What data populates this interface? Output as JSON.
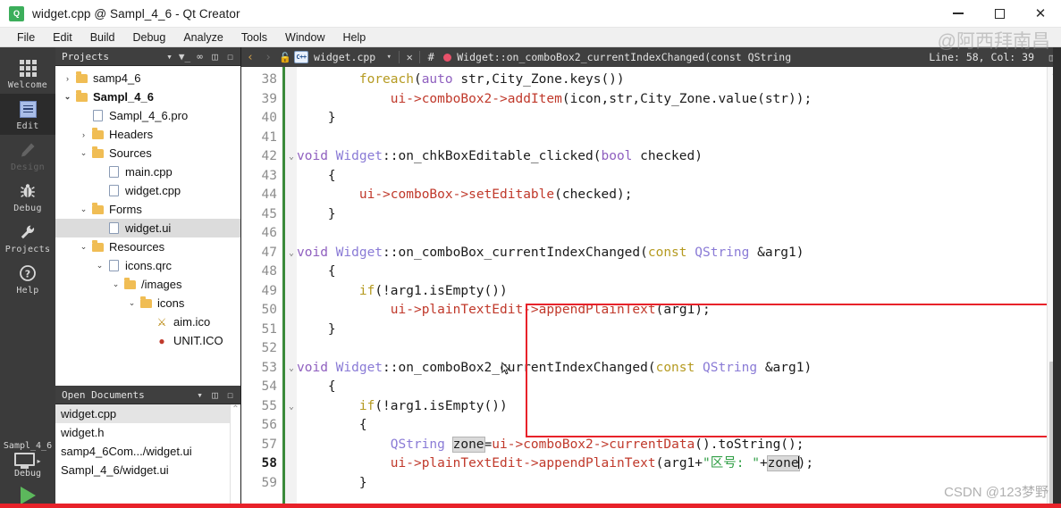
{
  "window": {
    "title": "widget.cpp @ Sampl_4_6 - Qt Creator",
    "app_icon": "qt-creator-icon",
    "minimize_label": "—",
    "maximize_label": "□",
    "close_label": "✕"
  },
  "menubar": {
    "items": [
      "File",
      "Edit",
      "Build",
      "Debug",
      "Analyze",
      "Tools",
      "Window",
      "Help"
    ]
  },
  "modebar": {
    "items": [
      {
        "label": "Welcome",
        "icon": "grid-icon",
        "state": "normal"
      },
      {
        "label": "Edit",
        "icon": "document-icon",
        "state": "active"
      },
      {
        "label": "Design",
        "icon": "pencil-icon",
        "state": "disabled"
      },
      {
        "label": "Debug",
        "icon": "bug-icon",
        "state": "normal"
      },
      {
        "label": "Projects",
        "icon": "wrench-icon",
        "state": "normal"
      },
      {
        "label": "Help",
        "icon": "question-icon",
        "state": "normal"
      }
    ],
    "kit": {
      "project": "Sampl_4_6",
      "build_config": "Debug",
      "selector_icon": "monitor-icon",
      "run_icon": "run-play-icon"
    }
  },
  "projects_panel": {
    "title": "Projects",
    "toolbar_icons": [
      "chevron-down-icon",
      "filter-icon",
      "link-icon",
      "split-icon",
      "close-icon"
    ],
    "tree": [
      {
        "label": "samp4_6",
        "depth": 0,
        "arrow": "›",
        "icon": "project-icon",
        "bold": false,
        "selected": false
      },
      {
        "label": "Sampl_4_6",
        "depth": 0,
        "arrow": "⌄",
        "icon": "project-icon",
        "bold": true,
        "selected": false
      },
      {
        "label": "Sampl_4_6.pro",
        "depth": 1,
        "arrow": "",
        "icon": "pro-file-icon",
        "bold": false,
        "selected": false
      },
      {
        "label": "Headers",
        "depth": 1,
        "arrow": "›",
        "icon": "folder-h-icon",
        "bold": false,
        "selected": false
      },
      {
        "label": "Sources",
        "depth": 1,
        "arrow": "⌄",
        "icon": "folder-c-icon",
        "bold": false,
        "selected": false
      },
      {
        "label": "main.cpp",
        "depth": 2,
        "arrow": "",
        "icon": "cpp-file-icon",
        "bold": false,
        "selected": false
      },
      {
        "label": "widget.cpp",
        "depth": 2,
        "arrow": "",
        "icon": "cpp-file-icon",
        "bold": false,
        "selected": false
      },
      {
        "label": "Forms",
        "depth": 1,
        "arrow": "⌄",
        "icon": "folder-ui-icon",
        "bold": false,
        "selected": false
      },
      {
        "label": "widget.ui",
        "depth": 2,
        "arrow": "",
        "icon": "ui-file-icon",
        "bold": false,
        "selected": true
      },
      {
        "label": "Resources",
        "depth": 1,
        "arrow": "⌄",
        "icon": "folder-qrc-icon",
        "bold": false,
        "selected": false
      },
      {
        "label": "icons.qrc",
        "depth": 2,
        "arrow": "⌄",
        "icon": "qrc-file-icon",
        "bold": false,
        "selected": false
      },
      {
        "label": "/images",
        "depth": 3,
        "arrow": "⌄",
        "icon": "folder-icon",
        "bold": false,
        "selected": false
      },
      {
        "label": "icons",
        "depth": 4,
        "arrow": "⌄",
        "icon": "folder-icon",
        "bold": false,
        "selected": false
      },
      {
        "label": "aim.ico",
        "depth": 5,
        "arrow": "",
        "icon": "aim-ico-icon",
        "bold": false,
        "selected": false
      },
      {
        "label": "UNIT.ICO",
        "depth": 5,
        "arrow": "",
        "icon": "unit-ico-icon",
        "bold": false,
        "selected": false
      }
    ]
  },
  "open_documents": {
    "title": "Open Documents",
    "toolbar_icons": [
      "chevron-down-icon",
      "split-icon",
      "close-icon"
    ],
    "scroll_up_icon": "⌃",
    "items": [
      {
        "label": "widget.cpp",
        "selected": true
      },
      {
        "label": "widget.h",
        "selected": false
      },
      {
        "label": "samp4_6Com.../widget.ui",
        "selected": false
      },
      {
        "label": "Sampl_4_6/widget.ui",
        "selected": false
      }
    ]
  },
  "editor": {
    "toolbar": {
      "back_icon": "‹",
      "forward_icon": "›",
      "lock_icon": "unlocked-icon",
      "file_icon": "cpp-file-icon",
      "filename": "widget.cpp",
      "dropdown_icon": "▾",
      "close_icon": "✕",
      "hash_icon": "#",
      "symbol_marker_icon": "bookmark-dot-icon",
      "symbol": "Widget::on_comboBox2_currentIndexChanged(const QString",
      "line_col": "Line: 58, Col: 39",
      "split_icon": "split-icon"
    },
    "first_line": 38,
    "current_line": 58,
    "lines": [
      {
        "n": 38,
        "fold": "",
        "indent": 8,
        "tokens": [
          {
            "t": "foreach",
            "c": "kw2"
          },
          {
            "t": "(",
            "c": ""
          },
          {
            "t": "auto",
            "c": "kw"
          },
          {
            "t": " str,City_Zone.keys())",
            "c": ""
          }
        ]
      },
      {
        "n": 39,
        "fold": "",
        "indent": 12,
        "tokens": [
          {
            "t": "ui",
            "c": "mem"
          },
          {
            "t": "->",
            "c": "mem"
          },
          {
            "t": "comboBox2",
            "c": "mem"
          },
          {
            "t": "->",
            "c": "mem"
          },
          {
            "t": "addItem",
            "c": "mem"
          },
          {
            "t": "(icon,str,City_Zone.value(str));",
            "c": ""
          }
        ]
      },
      {
        "n": 40,
        "fold": "",
        "indent": 4,
        "tokens": [
          {
            "t": "}",
            "c": ""
          }
        ]
      },
      {
        "n": 41,
        "fold": "",
        "indent": 0,
        "tokens": []
      },
      {
        "n": 42,
        "fold": "⌄",
        "indent": 0,
        "tokens": [
          {
            "t": "void",
            "c": "kw"
          },
          {
            "t": " ",
            "c": ""
          },
          {
            "t": "Widget",
            "c": "typ"
          },
          {
            "t": "::on_chkBoxEditable_clicked",
            "c": ""
          },
          {
            "t": "(",
            "c": ""
          },
          {
            "t": "bool",
            "c": "kw"
          },
          {
            "t": " checked)",
            "c": ""
          }
        ]
      },
      {
        "n": 43,
        "fold": "",
        "indent": 4,
        "tokens": [
          {
            "t": "{",
            "c": ""
          }
        ]
      },
      {
        "n": 44,
        "fold": "",
        "indent": 8,
        "tokens": [
          {
            "t": "ui",
            "c": "mem"
          },
          {
            "t": "->",
            "c": "mem"
          },
          {
            "t": "comboBox",
            "c": "mem"
          },
          {
            "t": "->",
            "c": "mem"
          },
          {
            "t": "setEditable",
            "c": "mem"
          },
          {
            "t": "(checked);",
            "c": ""
          }
        ]
      },
      {
        "n": 45,
        "fold": "",
        "indent": 4,
        "tokens": [
          {
            "t": "}",
            "c": ""
          }
        ]
      },
      {
        "n": 46,
        "fold": "",
        "indent": 0,
        "tokens": []
      },
      {
        "n": 47,
        "fold": "⌄",
        "indent": 0,
        "tokens": [
          {
            "t": "void",
            "c": "kw"
          },
          {
            "t": " ",
            "c": ""
          },
          {
            "t": "Widget",
            "c": "typ"
          },
          {
            "t": "::on_comboBox_currentIndexChanged",
            "c": ""
          },
          {
            "t": "(",
            "c": ""
          },
          {
            "t": "const",
            "c": "kw2"
          },
          {
            "t": " ",
            "c": ""
          },
          {
            "t": "QString",
            "c": "typ"
          },
          {
            "t": " &arg1)",
            "c": ""
          }
        ]
      },
      {
        "n": 48,
        "fold": "",
        "indent": 4,
        "tokens": [
          {
            "t": "{",
            "c": ""
          }
        ]
      },
      {
        "n": 49,
        "fold": "",
        "indent": 8,
        "tokens": [
          {
            "t": "if",
            "c": "kw2"
          },
          {
            "t": "(!arg1.isEmpty())",
            "c": ""
          }
        ]
      },
      {
        "n": 50,
        "fold": "",
        "indent": 12,
        "tokens": [
          {
            "t": "ui",
            "c": "mem"
          },
          {
            "t": "->",
            "c": "mem"
          },
          {
            "t": "plainTextEdit",
            "c": "mem"
          },
          {
            "t": "->",
            "c": "mem"
          },
          {
            "t": "appendPlainText",
            "c": "mem"
          },
          {
            "t": "(arg1);",
            "c": ""
          }
        ]
      },
      {
        "n": 51,
        "fold": "",
        "indent": 4,
        "tokens": [
          {
            "t": "}",
            "c": ""
          }
        ]
      },
      {
        "n": 52,
        "fold": "",
        "indent": 0,
        "tokens": []
      },
      {
        "n": 53,
        "fold": "⌄",
        "indent": 0,
        "tokens": [
          {
            "t": "void",
            "c": "kw"
          },
          {
            "t": " ",
            "c": ""
          },
          {
            "t": "Widget",
            "c": "typ"
          },
          {
            "t": "::on_comboBox2_currentIndexChanged",
            "c": ""
          },
          {
            "t": "(",
            "c": ""
          },
          {
            "t": "const",
            "c": "kw2"
          },
          {
            "t": " ",
            "c": ""
          },
          {
            "t": "QString",
            "c": "typ"
          },
          {
            "t": " &arg1)",
            "c": ""
          }
        ]
      },
      {
        "n": 54,
        "fold": "",
        "indent": 4,
        "tokens": [
          {
            "t": "{",
            "c": ""
          }
        ]
      },
      {
        "n": 55,
        "fold": "⌄",
        "indent": 8,
        "tokens": [
          {
            "t": "if",
            "c": "kw2"
          },
          {
            "t": "(!arg1.isEmpty())",
            "c": ""
          }
        ]
      },
      {
        "n": 56,
        "fold": "",
        "indent": 8,
        "tokens": [
          {
            "t": "{",
            "c": ""
          }
        ]
      },
      {
        "n": 57,
        "fold": "",
        "indent": 12,
        "tokens": [
          {
            "t": "QString",
            "c": "typ"
          },
          {
            "t": " ",
            "c": ""
          },
          {
            "t": "zone",
            "c": "hl"
          },
          {
            "t": "=",
            "c": ""
          },
          {
            "t": "ui",
            "c": "mem"
          },
          {
            "t": "->",
            "c": "mem"
          },
          {
            "t": "comboBox2",
            "c": "mem"
          },
          {
            "t": "->",
            "c": "mem"
          },
          {
            "t": "currentData",
            "c": "mem"
          },
          {
            "t": "().toString();",
            "c": ""
          }
        ]
      },
      {
        "n": 58,
        "fold": "",
        "indent": 12,
        "tokens": [
          {
            "t": "ui",
            "c": "mem"
          },
          {
            "t": "->",
            "c": "mem"
          },
          {
            "t": "plainTextEdit",
            "c": "mem"
          },
          {
            "t": "->",
            "c": "mem"
          },
          {
            "t": "appendPlainText",
            "c": "mem"
          },
          {
            "t": "(arg1+",
            "c": ""
          },
          {
            "t": "\"区号: \"",
            "c": "str"
          },
          {
            "t": "+",
            "c": ""
          },
          {
            "t": "zone",
            "c": "hl caret-after"
          },
          {
            "t": ");",
            "c": ""
          }
        ]
      },
      {
        "n": 59,
        "fold": "",
        "indent": 8,
        "tokens": [
          {
            "t": "}",
            "c": ""
          }
        ]
      }
    ],
    "annotation": {
      "shape": "rectangle",
      "color": "#e8222a",
      "covers_lines": "46-52"
    }
  },
  "watermarks": {
    "top_right": "@阿西拜南昌",
    "bottom_right": "CSDN @123梦野"
  }
}
